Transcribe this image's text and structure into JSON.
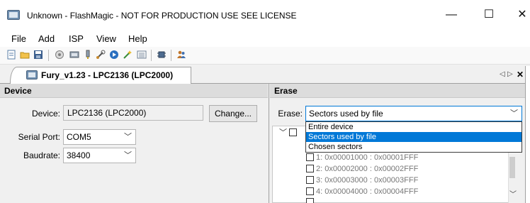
{
  "window": {
    "title": "Unknown - FlashMagic - NOT FOR PRODUCTION USE SEE LICENSE",
    "minimize": "—",
    "maximize": "☐",
    "close": "✕"
  },
  "menu": {
    "items": [
      "File",
      "Add",
      "ISP",
      "View",
      "Help"
    ]
  },
  "toolbar": {
    "icons": [
      "new-document-icon",
      "open-folder-icon",
      "save-icon",
      "connect-icon",
      "device-icon",
      "probe-icon",
      "tools-icon",
      "go-icon",
      "wizard-icon",
      "list-icon",
      "chip-icon",
      "people-icon"
    ]
  },
  "document_tab": {
    "label": "Fury_v1.23 - LPC2136 (LPC2000)",
    "prev": "◁",
    "next": "▷",
    "close": "✕"
  },
  "device_panel": {
    "header": "Device",
    "device_label": "Device:",
    "device_value": "LPC2136 (LPC2000)",
    "change_button": "Change...",
    "serial_label": "Serial Port:",
    "serial_value": "COM5",
    "baud_label": "Baudrate:",
    "baud_value": "38400"
  },
  "erase_panel": {
    "header": "Erase",
    "erase_label": "Erase:",
    "erase_value": "Sectors used by file",
    "options": [
      "Entire device",
      "Sectors used by file",
      "Chosen sectors"
    ],
    "selected_index": 1,
    "sectors": [
      "1: 0x00001000 : 0x00001FFF",
      "2: 0x00002000 : 0x00002FFF",
      "3: 0x00003000 : 0x00003FFF",
      "4: 0x00004000 : 0x00004FFF"
    ]
  },
  "colors": {
    "selection": "#0078d7",
    "panel_header": "#dcdcdc"
  }
}
